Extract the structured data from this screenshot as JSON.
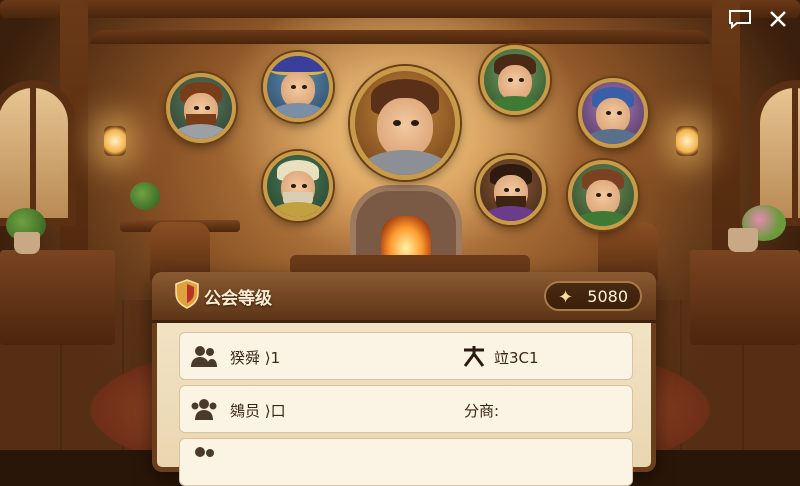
{
  "panel": {
    "title": "公会等级",
    "currency_value": "5080",
    "rows": [
      {
        "left_label": "猤舜 ⟩1",
        "right_label": "竝3C1"
      },
      {
        "left_label": "鵕员 ⟩口",
        "right_label": "分商:"
      },
      {
        "left_label": "",
        "right_label": ""
      }
    ]
  },
  "icons": {
    "chat": "chat-bubble-icon",
    "close": "close-icon",
    "shield": "guild-shield-icon",
    "currency": "sparkle-star-icon",
    "members": "users-icon",
    "rank": "rank-figure-icon"
  }
}
